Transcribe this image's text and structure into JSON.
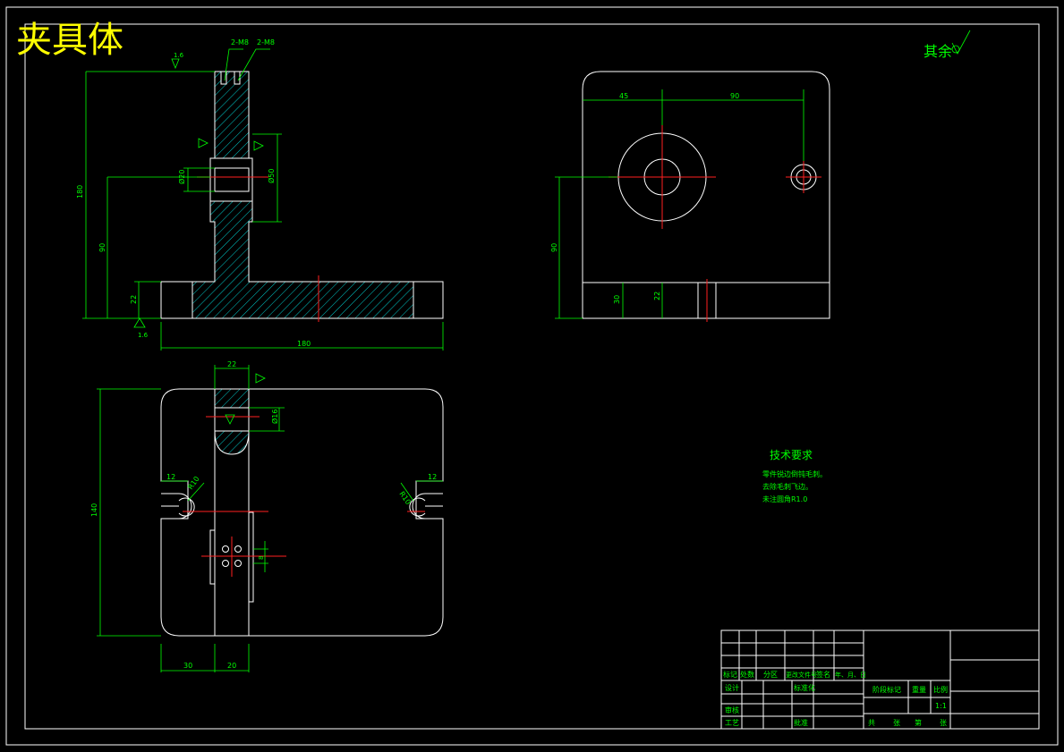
{
  "drawing_title": "夹具体",
  "surface_note": "其余",
  "tech_requirements": {
    "title": "技术要求",
    "items": [
      "零件锐边倒钝毛刺。",
      "去除毛刺飞边。",
      "未注圆角R1.0"
    ]
  },
  "roughness": {
    "ra": "1.6"
  },
  "front_view_dims": {
    "total_height": "180",
    "hole_center_height": "90",
    "base_height": "22",
    "total_width": "180",
    "upper_width": "22",
    "hole_dia": "Ø20",
    "bore_dia": "Ø50",
    "slot1": "2-M8",
    "slot2": "2-M8"
  },
  "side_view_dims": {
    "left_offset": "45",
    "hole_spacing": "90",
    "hole_height": "90",
    "base_h1": "30",
    "base_h2": "22"
  },
  "top_view_dims": {
    "thickness": "22",
    "total_depth": "140",
    "left_slot": "12",
    "right_slot": "12",
    "left_r": "R10",
    "right_r": "R10",
    "left_base": "30",
    "right_base": "20",
    "bore_dia": "Ø16",
    "hole_pitch": "8"
  },
  "title_block": {
    "header_labels": [
      "标记",
      "处数",
      "分区",
      "更改文件号",
      "签名",
      "年、月、日"
    ],
    "row_labels": [
      "设计",
      "标准化",
      "审核",
      "工艺",
      "批准"
    ],
    "right_labels": [
      "阶段标记",
      "重量",
      "比例"
    ],
    "scale": "1:1",
    "sheet_labels": [
      "共",
      "张",
      "第",
      "张"
    ]
  },
  "colors": {
    "background": "#000000",
    "outline": "#ffffff",
    "dimension": "#00ff00",
    "centerline": "#ff2020",
    "title": "#ffff00"
  }
}
